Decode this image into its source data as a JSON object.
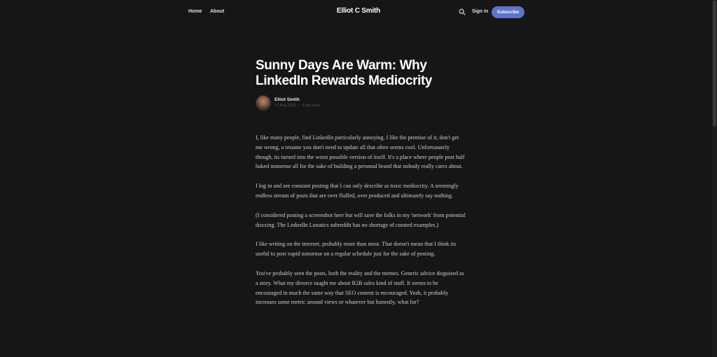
{
  "nav": {
    "home": "Home",
    "about": "About",
    "site_title": "Elliot C Smith",
    "sign_in": "Sign in",
    "subscribe": "Subscribe"
  },
  "post": {
    "title": "Sunny Days Are Warm: Why LinkedIn Rewards Mediocrity",
    "author": "Elliot Smith",
    "date": "17 Aug 2025",
    "separator": "•",
    "read_time": "3 min read",
    "paragraphs": [
      "I, like many people, find LinkedIn particularly annoying. I like the premise of it, don't get me wrong, a resume you don't need to update all that often seems cool. Unfortunately though, its turned into the worst possible version of itself. It's a place where people post half baked nonsense all for the sake of building a personal brand that nobody really cares about.",
      "I log in and see constant posting that I can only describe as toxic mediocrity. A seemingly endless stream of posts that are over fluffed, over produced and ultimately say nothing.",
      "(I considered posting a screenshot here but will save the folks in my 'network' from potential doxxing. The LinkedIn Lunatics subreddit has no shortage of curated examples.)",
      "I like writing on the internet, probably more than most. That doesn't mean that I think its useful to post vapid nonsense on a regular schedule just for the sake of posting.",
      "You've probably seen the posts, both the reality and the memes. Generic advice disguised as a story. What my divorce taught me about B2B sales kind of stuff. It seems to be encouraged in much the same way that SEO content is encouraged. Yeah, it probably increases some metric around views or whatever but honestly, what for?"
    ]
  },
  "colors": {
    "background": "#161616",
    "accent": "#5f73c9"
  },
  "icons": {
    "search": "search-icon",
    "avatar": "avatar"
  }
}
